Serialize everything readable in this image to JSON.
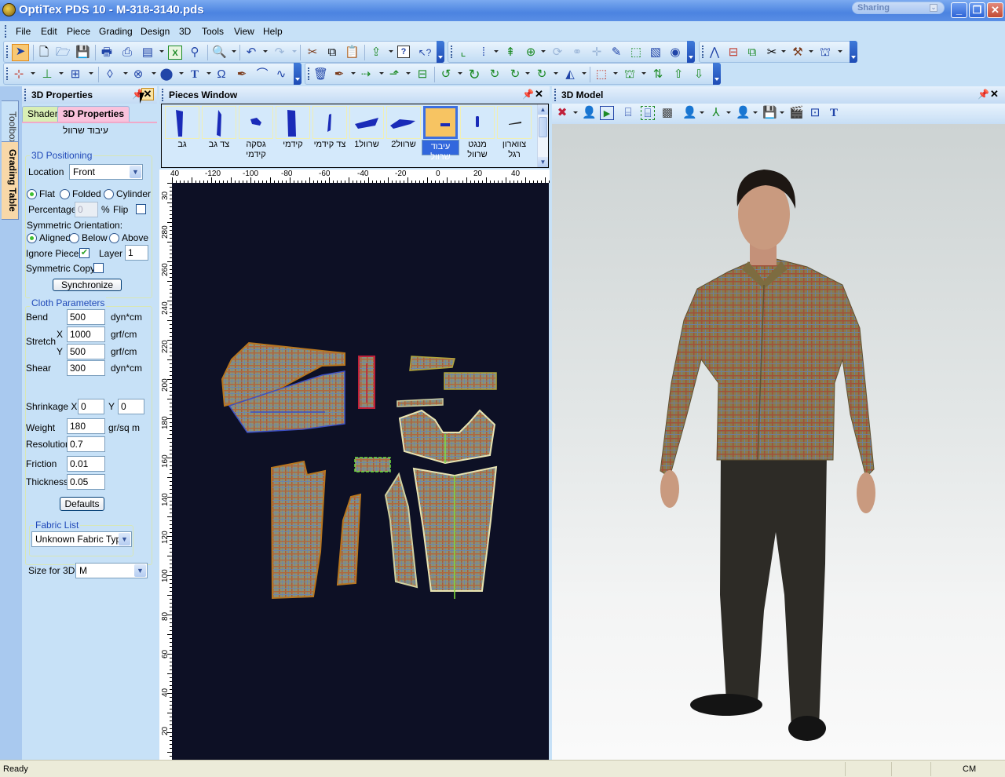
{
  "window": {
    "title": "OptiTex PDS 10 - M-318-3140.pds",
    "sharing_label": "Sharing",
    "minimize": "_",
    "maximize": "❐",
    "close": "✕"
  },
  "menu": [
    "File",
    "Edit",
    "Piece",
    "Grading",
    "Design",
    "3D",
    "Tools",
    "View",
    "Help"
  ],
  "toolbar_icons": {
    "row1_a": [
      "select-arrow",
      "new-file",
      "open-folder",
      "save",
      "print",
      "plot",
      "layout",
      "excel-export",
      "piece-query",
      "zoom",
      "undo",
      "redo"
    ],
    "row1_b": [
      "cut",
      "copy",
      "paste",
      "import-piece",
      "help",
      "context-help"
    ],
    "row1_c": [
      "curve-tool",
      "point-grid",
      "add-notch",
      "add-point",
      "rotate-piece",
      "sew-points",
      "cross-point",
      "cut-line",
      "piece-info",
      "fold-piece",
      "color-circle"
    ],
    "row1_d": [
      "dart-tool",
      "measure-tape",
      "piece-add",
      "scissors-piece",
      "hammer-piece",
      "piece-outline"
    ],
    "row2_a": [
      "add-points",
      "perpendicular",
      "add-piece",
      "fold-shape",
      "circle-point",
      "button",
      "text",
      "loop",
      "pen-curve",
      "arc",
      "wave"
    ],
    "row2_b": [
      "delete",
      "pen-tool",
      "move-point",
      "piece-arrow",
      "frame",
      "rotate-left",
      "rotate-right",
      "rotate-red",
      "rotate-line",
      "rotate-dashed",
      "mirror",
      "corner-cut",
      "piece-notch",
      "swap",
      "piece-up",
      "piece-down"
    ]
  },
  "side_tabs": [
    "Toolbox",
    "Grading Table"
  ],
  "props_panel": {
    "title": "3D Properties",
    "tabs": [
      "Shader",
      "3D Properties"
    ],
    "active_tab": "3D Properties",
    "piece_name": "עיבוד שרוול",
    "positioning": {
      "group_label": "3D Positioning",
      "location_label": "Location",
      "location_value": "Front",
      "shape_options": [
        "Flat",
        "Folded",
        "Cylinder"
      ],
      "shape_selected": "Flat",
      "percentage_label": "Percentage",
      "percentage_value": "0",
      "percent_sign": "%",
      "flip_label": "Flip",
      "flip_checked": false,
      "sym_orient_label": "Symmetric Orientation:",
      "orient_options": [
        "Aligned",
        "Below",
        "Above"
      ],
      "orient_selected": "Aligned",
      "ignore_piece_label": "Ignore Piece",
      "ignore_piece_checked": true,
      "layer_label": "Layer",
      "layer_value": "1",
      "sym_copy_label": "Symmetric Copy",
      "sym_copy_checked": false,
      "sync_button": "Synchronize"
    },
    "cloth": {
      "group_label": "Cloth Parameters",
      "bend_label": "Bend",
      "bend_value": "500",
      "bend_unit": "dyn*cm",
      "stretch_label": "Stretch",
      "stretch_x_label": "X",
      "stretch_x_value": "1000",
      "stretch_x_unit": "grf/cm",
      "stretch_y_label": "Y",
      "stretch_y_value": "500",
      "stretch_y_unit": "grf/cm",
      "shear_label": "Shear",
      "shear_value": "300",
      "shear_unit": "dyn*cm",
      "shrink_label": "Shrinkage X",
      "shrink_x_value": "0",
      "shrink_y_label": "Y",
      "shrink_y_value": "0",
      "weight_label": "Weight",
      "weight_value": "180",
      "weight_unit": "gr/sq m",
      "resolution_label": "Resolution",
      "resolution_value": "0.7",
      "friction_label": "Friction",
      "friction_value": "0.01",
      "thickness_label": "Thickness",
      "thickness_value": "0.05",
      "defaults_button": "Defaults"
    },
    "fabric": {
      "group_label": "Fabric List",
      "value": "Unknown Fabric Type"
    },
    "size": {
      "label": "Size for 3D",
      "value": "M"
    }
  },
  "pieces_window": {
    "title": "Pieces Window",
    "pieces": [
      {
        "label": "גב",
        "selected": false
      },
      {
        "label": "צד גב",
        "selected": false
      },
      {
        "label": "גסקה קידמי",
        "selected": false
      },
      {
        "label": "קידמי",
        "selected": false
      },
      {
        "label": "צד קידמי",
        "selected": false
      },
      {
        "label": "שרוול1",
        "selected": false
      },
      {
        "label": "שרוול2",
        "selected": false
      },
      {
        "label": "עיבוד שרוול",
        "selected": true
      },
      {
        "label": "מנגט שרוול",
        "selected": false
      },
      {
        "label": "צווארון רגל",
        "selected": false
      }
    ],
    "h_ruler": [
      "40",
      "-120",
      "-100",
      "-80",
      "-60",
      "-40",
      "-20",
      "0",
      "20",
      "40"
    ],
    "v_ruler": [
      "30",
      "280",
      "260",
      "240",
      "220",
      "200",
      "180",
      "160",
      "140",
      "120",
      "100",
      "80",
      "60",
      "40",
      "20"
    ]
  },
  "model_window": {
    "title": "3D Model",
    "toolbar_icons": [
      "remove-avatar",
      "avatar-properties",
      "simulate-play",
      "cylinder-view",
      "bounding-box",
      "texture-export",
      "avatar-settings",
      "axis",
      "avatar-tools",
      "save-avatar",
      "animation-clapper",
      "fit-view",
      "text-tool"
    ],
    "colors": {
      "shirt": "#8b7a4a",
      "pants": "#2d2b26",
      "skin": "#c99a7f"
    }
  },
  "status": {
    "text": "Ready",
    "unit": "CM"
  }
}
